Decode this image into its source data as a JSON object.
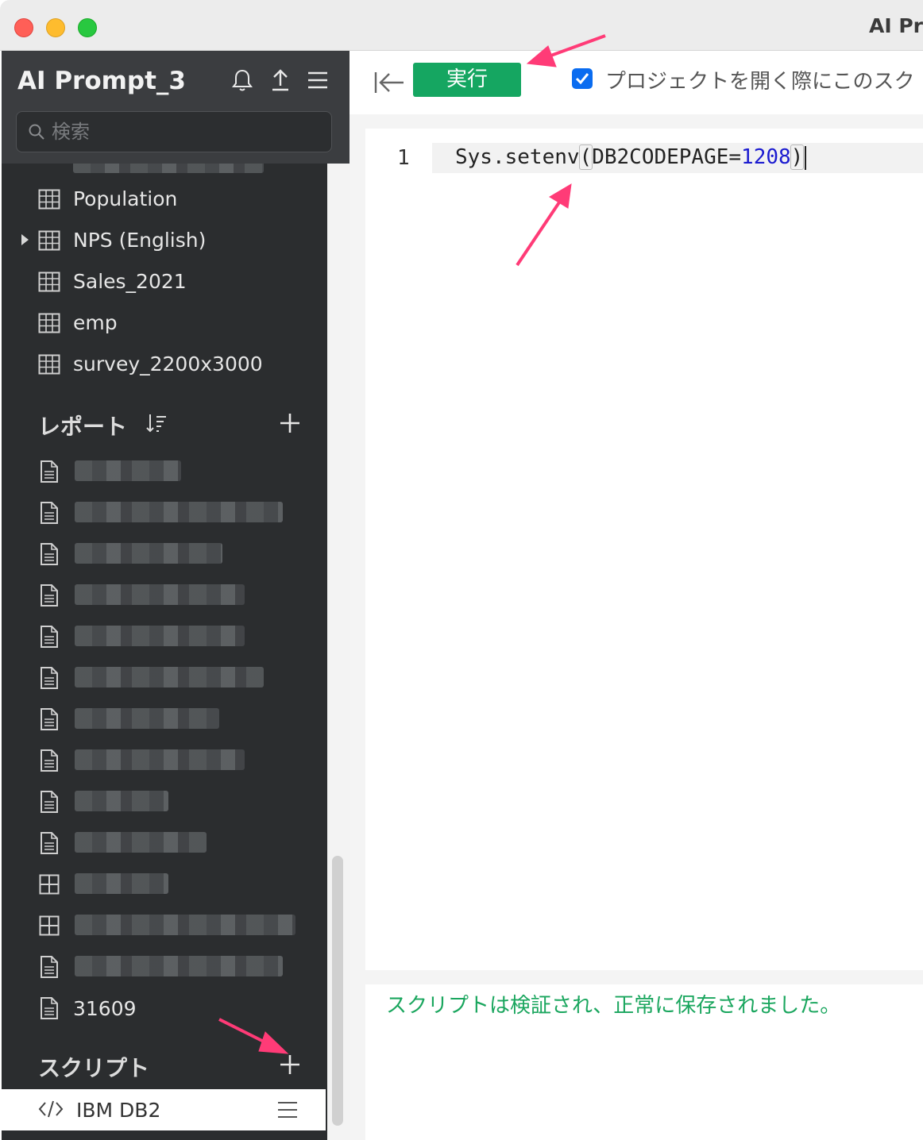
{
  "window": {
    "title": "AI Pro"
  },
  "sidebar": {
    "project_name": "AI Prompt_3",
    "search": {
      "placeholder": "検索",
      "value": ""
    },
    "datasets": [
      {
        "label": "Population",
        "expandable": false
      },
      {
        "label": "NPS (English)",
        "expandable": true
      },
      {
        "label": "Sales_2021",
        "expandable": false
      },
      {
        "label": "emp",
        "expandable": false
      },
      {
        "label": "survey_2200x3000",
        "expandable": false
      }
    ],
    "reports_title": "レポート",
    "reports": [
      {
        "icon": "document-icon",
        "label": ""
      },
      {
        "icon": "document-icon",
        "label": ""
      },
      {
        "icon": "document-icon",
        "label": ""
      },
      {
        "icon": "document-icon",
        "label": ""
      },
      {
        "icon": "document-icon",
        "label": ""
      },
      {
        "icon": "document-icon",
        "label": ""
      },
      {
        "icon": "document-icon",
        "label": ""
      },
      {
        "icon": "document-icon",
        "label": ""
      },
      {
        "icon": "document-icon",
        "label": ""
      },
      {
        "icon": "document-icon",
        "label": ""
      },
      {
        "icon": "dashboard-icon",
        "label": ""
      },
      {
        "icon": "dashboard-icon",
        "label": ""
      },
      {
        "icon": "document-icon",
        "label": ""
      },
      {
        "icon": "document-icon",
        "label": "31609"
      }
    ],
    "scripts_title": "スクリプト",
    "scripts": [
      {
        "label": "IBM DB2",
        "selected": true
      }
    ]
  },
  "toolbar": {
    "run_label": "実行",
    "run_color": "#15a661",
    "checkbox_checked": true,
    "checkbox_label": "プロジェクトを開く際にこのスク"
  },
  "editor": {
    "line_number": "1",
    "code": {
      "fn": "Sys.setenv",
      "arg": "DB2CODEPAGE=",
      "num": "1208"
    }
  },
  "status": {
    "message": "スクリプトは検証され、正常に保存されました。",
    "color": "#1aa65e"
  },
  "annotation_color": "#ff3b77"
}
